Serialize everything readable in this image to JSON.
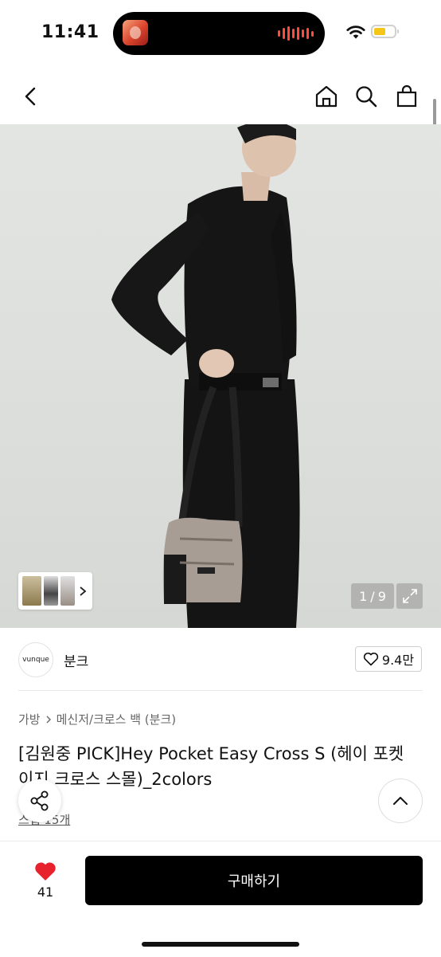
{
  "status_bar": {
    "time": "11:41",
    "battery_color": "#f5c518",
    "recording_color": "#ff4b3a"
  },
  "nav": {
    "back_icon": "chevron-left-icon",
    "home_icon": "home-icon",
    "search_icon": "search-icon",
    "bag_icon": "shopping-bag-icon"
  },
  "gallery": {
    "counter": "1 / 9",
    "current": "1",
    "separator": "/",
    "total": "9"
  },
  "brand": {
    "logo_text": "vunque",
    "name": "분크",
    "like_count": "9.4만"
  },
  "breadcrumb": {
    "items": [
      "가방",
      "메신저/크로스 백 (분크)"
    ]
  },
  "product": {
    "title": "[김원중 PICK]Hey Pocket Easy Cross S (헤이 포켓 이지 크로스 스몰)_2colors",
    "reviews": "스냅 15개"
  },
  "bottom": {
    "wish_count": "41",
    "buy_label": "구매하기",
    "heart_color": "#e8222c"
  }
}
